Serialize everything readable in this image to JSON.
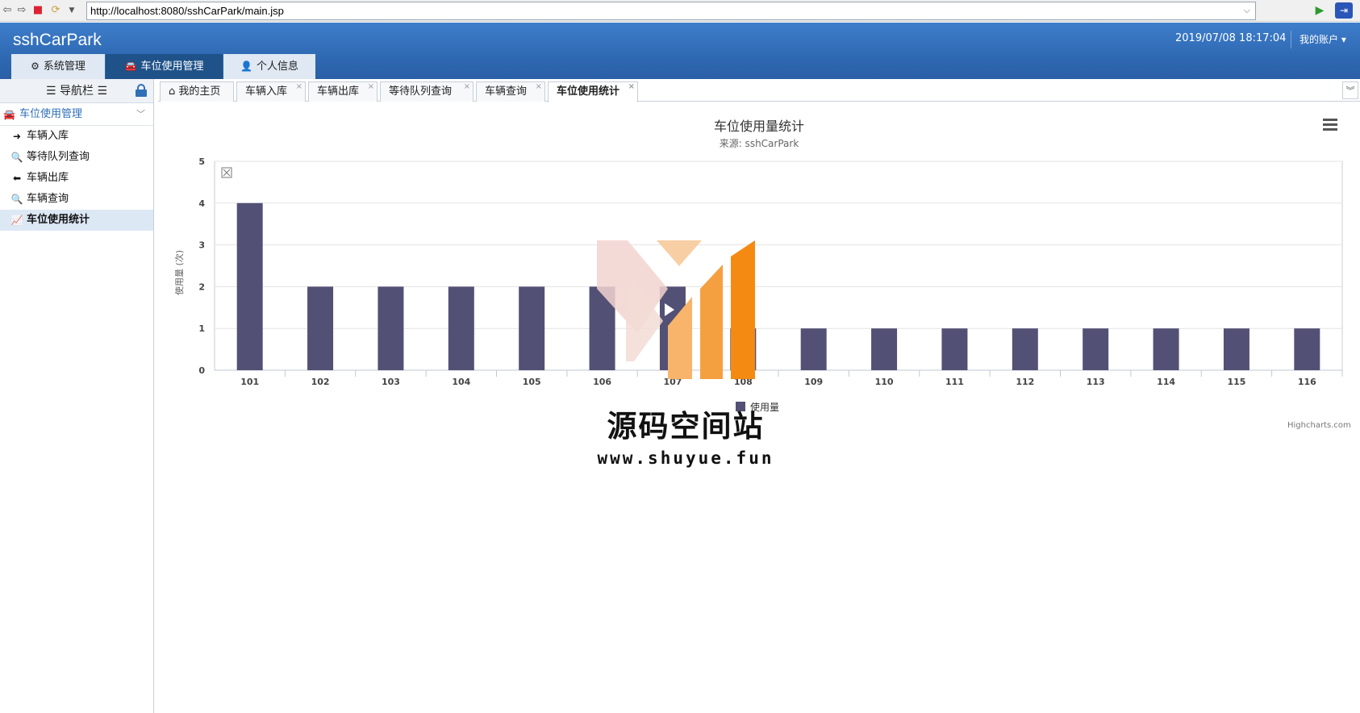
{
  "browser": {
    "url": "http://localhost:8080/sshCarPark/main.jsp"
  },
  "header": {
    "brand": "sshCarPark",
    "clock": "2019/07/08 18:17:04",
    "account": "我的账户 ▾",
    "nav": [
      {
        "label": "系统管理",
        "icon": "gear-icon"
      },
      {
        "label": "车位使用管理",
        "icon": "car-icon"
      },
      {
        "label": "个人信息",
        "icon": "user-icon"
      }
    ]
  },
  "sidebar": {
    "title": "导航栏",
    "group": "车位使用管理",
    "items": [
      {
        "label": "车辆入库",
        "icon": "arrow-circle-right-icon"
      },
      {
        "label": "等待队列查询",
        "icon": "search-icon"
      },
      {
        "label": "车辆出库",
        "icon": "arrow-circle-left-icon"
      },
      {
        "label": "车辆查询",
        "icon": "search-icon"
      },
      {
        "label": "车位使用统计",
        "icon": "line-chart-icon"
      }
    ]
  },
  "tabs": [
    {
      "label": "我的主页",
      "closable": false
    },
    {
      "label": "车辆入库",
      "closable": true
    },
    {
      "label": "车辆出库",
      "closable": true
    },
    {
      "label": "等待队列查询",
      "closable": true
    },
    {
      "label": "车辆查询",
      "closable": true
    },
    {
      "label": "车位使用统计",
      "closable": true,
      "active": true
    }
  ],
  "chart_data": {
    "type": "bar",
    "title": "车位使用量统计",
    "subtitle": "来源: sshCarPark",
    "ylabel": "使用量 (次)",
    "xlabel": "",
    "ylim": [
      0,
      5
    ],
    "yticks": [
      0,
      1,
      2,
      3,
      4,
      5
    ],
    "categories": [
      "101",
      "102",
      "103",
      "104",
      "105",
      "106",
      "107",
      "108",
      "109",
      "110",
      "111",
      "112",
      "113",
      "114",
      "115",
      "116"
    ],
    "series": [
      {
        "name": "使用量",
        "values": [
          4,
          2,
          2,
          2,
          2,
          2,
          2,
          1,
          1,
          1,
          1,
          1,
          1,
          1,
          1,
          1
        ],
        "color": "#535075"
      }
    ],
    "legend": "bottom-center",
    "grid": true,
    "credits": "Highcharts.com"
  },
  "watermark": {
    "text": "源码空间站",
    "url": "www.shuyue.fun"
  }
}
